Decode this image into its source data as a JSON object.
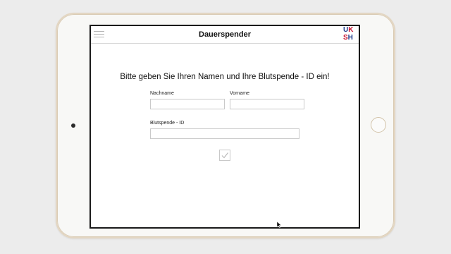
{
  "app": {
    "title": "Dauerspender",
    "logo_line1": "UK",
    "logo_line2": "SH"
  },
  "form": {
    "prompt": "Bitte geben Sie Ihren Namen und Ihre Blutspende - ID ein!",
    "lastname_label": "Nachname",
    "lastname_value": "",
    "firstname_label": "Vorname",
    "firstname_value": "",
    "donation_id_label": "Blutspende - ID",
    "donation_id_value": ""
  },
  "icons": {
    "menu": "hamburger-menu-icon",
    "submit": "checkmark-icon"
  },
  "colors": {
    "logo_blue": "#1f3b8a",
    "logo_red": "#c8102e",
    "tablet_frame": "#e3d6c2"
  }
}
